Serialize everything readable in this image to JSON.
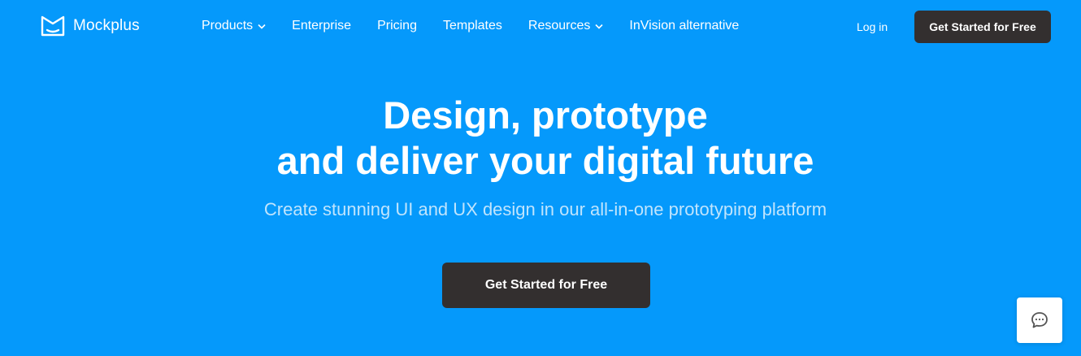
{
  "brand": {
    "name": "Mockplus",
    "icon": "mockplus-logo-icon"
  },
  "nav": {
    "items": [
      {
        "label": "Products",
        "has_dropdown": true
      },
      {
        "label": "Enterprise",
        "has_dropdown": false
      },
      {
        "label": "Pricing",
        "has_dropdown": false
      },
      {
        "label": "Templates",
        "has_dropdown": false
      },
      {
        "label": "Resources",
        "has_dropdown": true
      },
      {
        "label": "InVision alternative",
        "has_dropdown": false
      }
    ],
    "login_label": "Log in",
    "cta_label": "Get Started for Free"
  },
  "hero": {
    "title_line1": "Design, prototype",
    "title_line2": "and deliver your digital future",
    "subtitle": "Create stunning UI and UX design in our all-in-one prototyping platform",
    "cta_label": "Get Started for Free"
  },
  "chat": {
    "icon": "chat-bubble-icon"
  },
  "colors": {
    "background": "#0599fb",
    "button": "#332f2f",
    "text": "#ffffff",
    "subtitle": "#bfe4fd"
  }
}
